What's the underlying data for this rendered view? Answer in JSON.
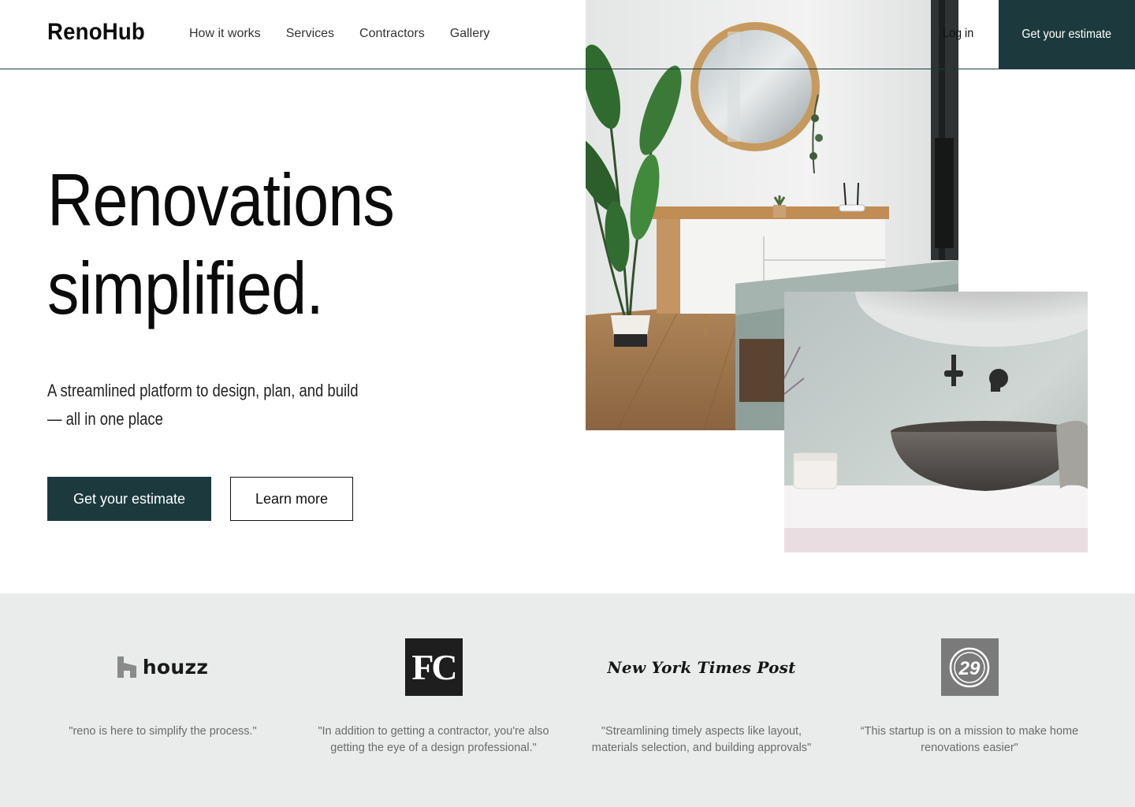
{
  "brand": {
    "name": "RenoHub"
  },
  "nav": {
    "items": [
      {
        "label": "How it works"
      },
      {
        "label": "Services"
      },
      {
        "label": "Contractors"
      },
      {
        "label": "Gallery"
      }
    ],
    "login_label": "Log in",
    "cta_label": "Get your estimate"
  },
  "hero": {
    "title_line1": "Renovations",
    "title_line2": "simplified.",
    "subtitle_line1": "A streamlined platform to design, plan, and build",
    "subtitle_line2": "— all in one place",
    "primary_button": "Get your estimate",
    "secondary_button": "Learn more"
  },
  "press": {
    "items": [
      {
        "logo_name": "houzz",
        "logo_text": "houzz",
        "quote": "\"reno is here to simplify the process.\""
      },
      {
        "logo_name": "fc",
        "logo_text": "FC",
        "quote": "\"In addition to getting a contractor, you're also getting the eye of a design professional.\""
      },
      {
        "logo_name": "new-york-times-post",
        "logo_text": "New York Times Post",
        "quote": "\"Streamlining timely aspects like layout, materials selection, and building approvals\""
      },
      {
        "logo_name": "refinery29",
        "logo_text": "29",
        "quote": "“This startup is on a mission to make home renovations easier\""
      }
    ]
  },
  "colors": {
    "accent": "#1c3a3e",
    "press_background": "#e9ecea",
    "quote_text": "#6b6b6b"
  }
}
